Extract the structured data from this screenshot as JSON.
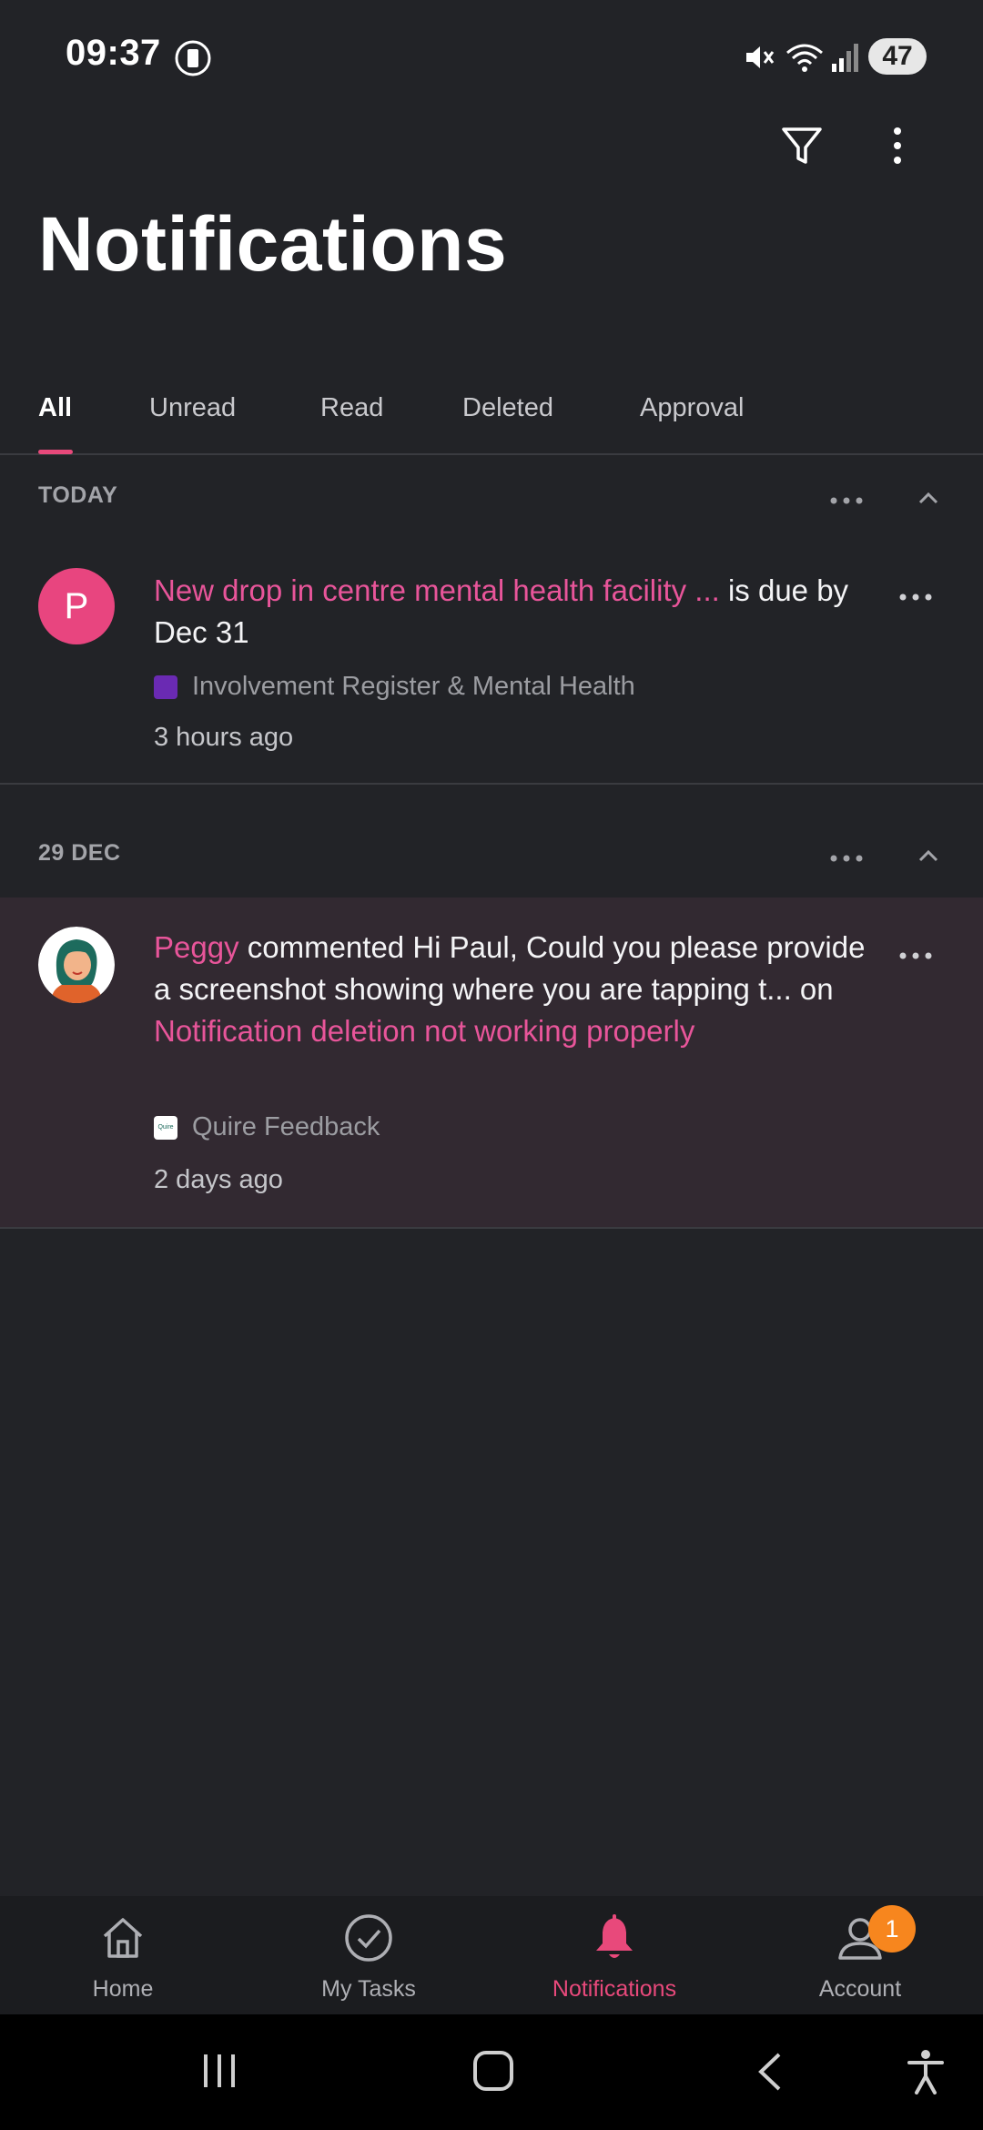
{
  "status_bar": {
    "time": "09:37",
    "battery": "47",
    "icons": [
      "screenshot-record-icon",
      "mute-icon",
      "wifi-icon",
      "signal-icon"
    ]
  },
  "header": {
    "title": "Notifications",
    "actions": [
      "filter-icon",
      "more-vertical-icon"
    ]
  },
  "tabs": [
    {
      "label": "All",
      "active": true
    },
    {
      "label": "Unread",
      "active": false
    },
    {
      "label": "Read",
      "active": false
    },
    {
      "label": "Deleted",
      "active": false
    },
    {
      "label": "Approval",
      "active": false
    }
  ],
  "sections": [
    {
      "label": "TODAY",
      "items": [
        {
          "avatar_letter": "P",
          "avatar_color": "#e8457f",
          "link_text": "New drop in centre mental health facility ...",
          "rest_text": " is due by Dec 31",
          "project": "Involvement Register & Mental Health",
          "project_color": "#6a2ab3",
          "time": "3 hours ago"
        }
      ]
    },
    {
      "label": "29 DEC",
      "items": [
        {
          "author": "Peggy",
          "middle_text": " commented Hi Paul, Could you please provide a screenshot showing where you are tapping t... on ",
          "link_text": "Notification deletion not working properly",
          "project": "Quire Feedback",
          "project_icon_text": "Quire",
          "time": "2 days ago"
        }
      ]
    }
  ],
  "bottom_nav": [
    {
      "label": "Home",
      "icon": "home-icon",
      "active": false
    },
    {
      "label": "My Tasks",
      "icon": "check-circle-icon",
      "active": false
    },
    {
      "label": "Notifications",
      "icon": "bell-icon",
      "active": true
    },
    {
      "label": "Account",
      "icon": "account-icon",
      "active": false,
      "badge": "1"
    }
  ],
  "colors": {
    "accent": "#e8497b",
    "background": "#222327",
    "highlight_row": "#322931",
    "badge": "#f7861e"
  }
}
